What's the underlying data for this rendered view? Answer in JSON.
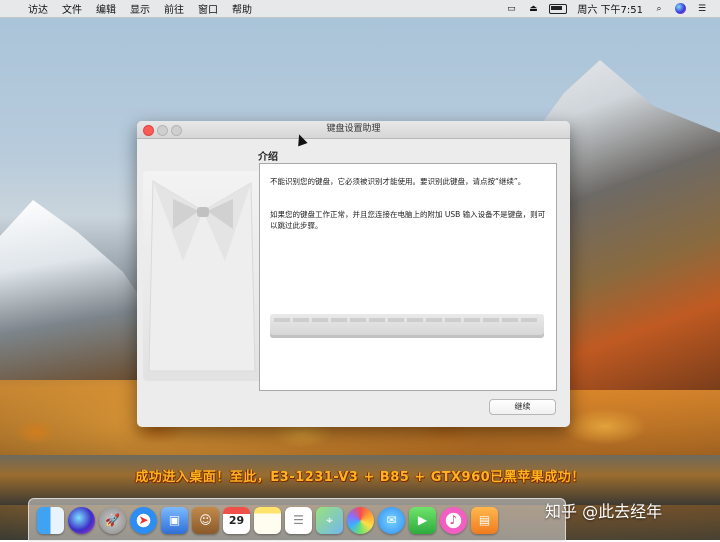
{
  "menubar": {
    "items": [
      "访达",
      "文件",
      "编辑",
      "显示",
      "前往",
      "窗口",
      "帮助"
    ],
    "clock": "周六 下午7:51"
  },
  "window": {
    "title": "键盘设置助理",
    "section_title": "介绍",
    "paragraph1": "不能识别您的键盘，它必须被识别才能使用。要识别此键盘，请点按“继续”。",
    "paragraph2": "如果您的键盘工作正常，并且您连接在电脑上的附加 USB 输入设备不是键盘，则可以跳过此步骤。",
    "continue_label": "继续"
  },
  "caption": "成功进入桌面！至此，E3-1231-V3 + B85 + GTX960已黑苹果成功！",
  "calendar_day": "29",
  "watermark": "知乎 @此去经年",
  "dock": {
    "icons": [
      "finder-icon",
      "siri-icon",
      "launchpad-icon",
      "safari-icon",
      "preview-icon",
      "contacts-icon",
      "calendar-icon",
      "notes-icon",
      "reminders-icon",
      "maps-icon",
      "photos-icon",
      "messages-icon",
      "facetime-icon",
      "music-icon",
      "books-icon"
    ]
  },
  "colors": {
    "caption": "#ffb31e",
    "close_button": "#fc5b57",
    "menubar": "#ececec"
  }
}
